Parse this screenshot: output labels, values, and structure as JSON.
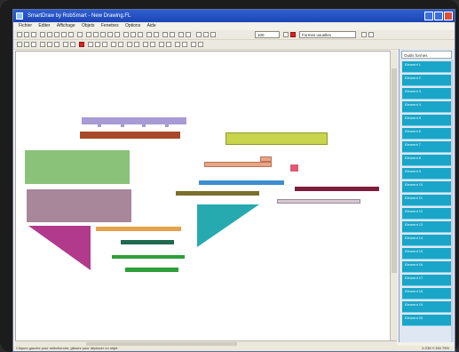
{
  "window": {
    "title": "SmartDraw by RobSmart - New Drawing.FL",
    "colors": {
      "titlebar": "#2f5fd0",
      "panel_item": "#1aa6c8"
    }
  },
  "menu": [
    "Fichier",
    "Editer",
    "Affichage",
    "Objets",
    "Fenetres",
    "Options",
    "Aide"
  ],
  "toolbar": {
    "zoom_value": "100",
    "font_dropdown": "Formes usuelles"
  },
  "panel": {
    "header": "Outils formes",
    "items": [
      "Element 1",
      "Element 2",
      "Element 3",
      "Element 4",
      "Element 5",
      "Element 6",
      "Element 7",
      "Element 8",
      "Element 9",
      "Element 10",
      "Element 11",
      "Element 12",
      "Element 13",
      "Element 14",
      "Element 15",
      "Element 16",
      "Element 17",
      "Element 18",
      "Element 19",
      "Element 20"
    ]
  },
  "status": {
    "left": "Cliquez gauche pour sélectionner, glissez pour déplacer un objet",
    "right": "X:236 Y:150 75%"
  },
  "shapes": {
    "colors": {
      "lavender": "#a89ad4",
      "rust": "#a8492b",
      "lime": "#c8d44c",
      "green": "#8ac27a",
      "mauve": "#a8879a",
      "magenta": "#b23a8c",
      "orange": "#e6a14a",
      "darkgreen": "#1f6a4f",
      "teal": "#27a9b0",
      "blue": "#3c8ed0",
      "olive": "#7a6e2a",
      "salmon": "#e9a584",
      "pink": "#e05a76",
      "maroon": "#7f1e3c",
      "grey": "#d6c8d0",
      "bright-green": "#2e9e3a"
    }
  }
}
